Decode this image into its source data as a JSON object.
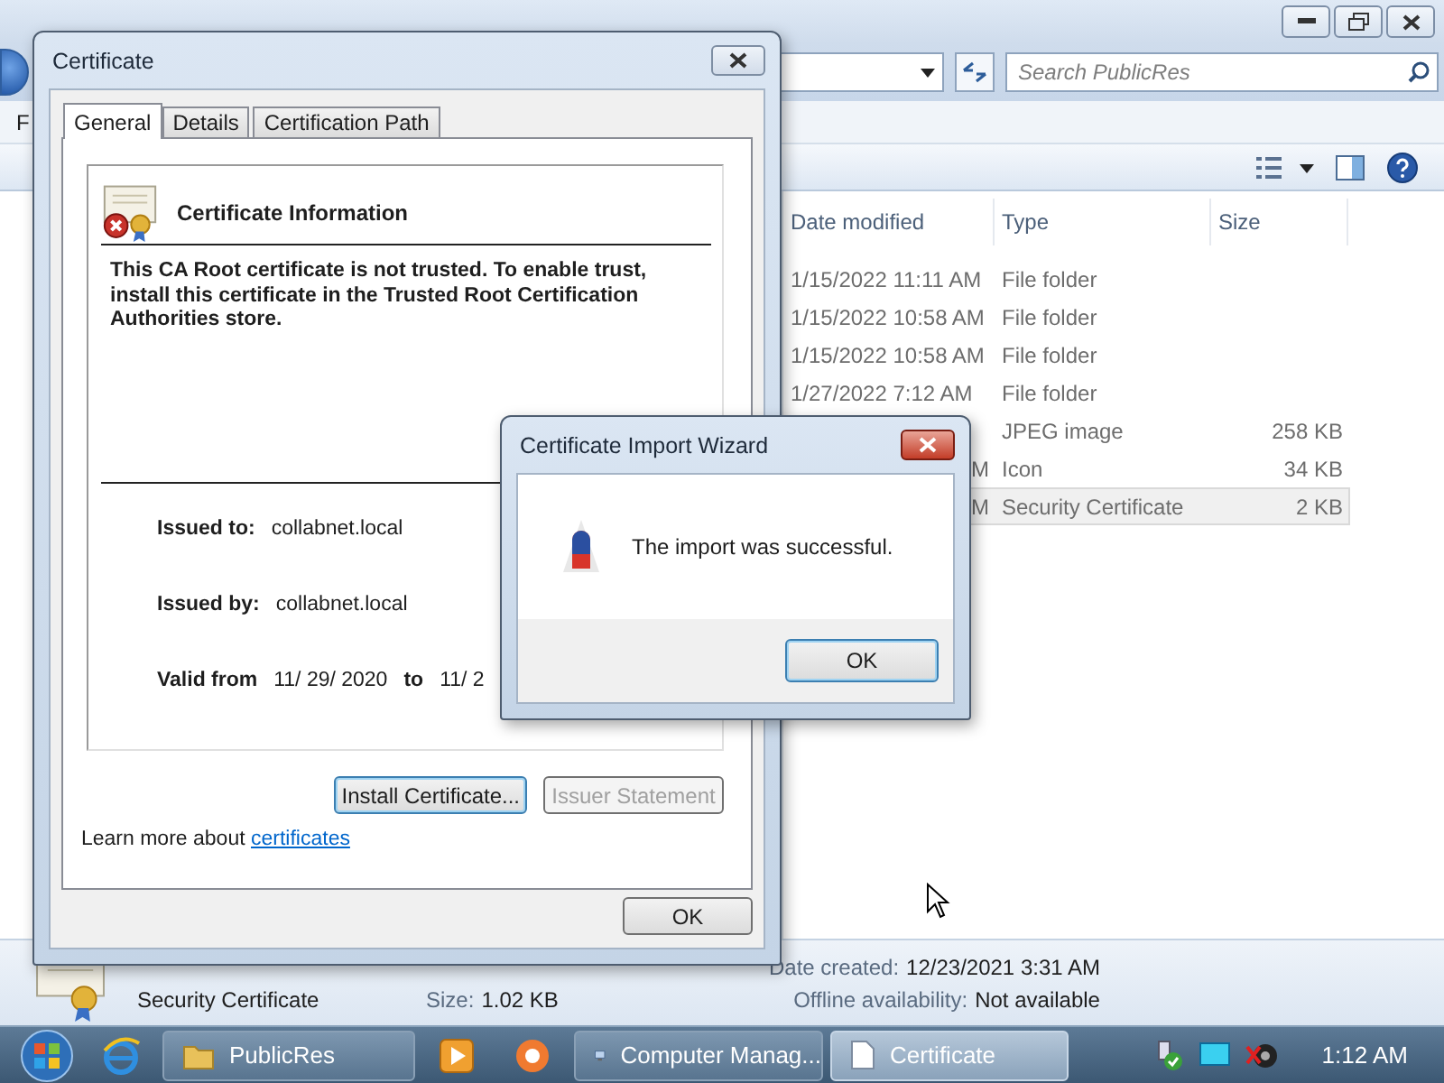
{
  "explorer": {
    "search": {
      "placeholder": "Search PublicRes"
    },
    "menu_fragment": "F",
    "columns": [
      "Date modified",
      "Type",
      "Size"
    ],
    "rows": [
      {
        "date": "1/15/2022 11:11 AM",
        "type": "File folder",
        "selected": false
      },
      {
        "date": "1/15/2022 10:58 AM",
        "type": "File folder",
        "selected": false
      },
      {
        "date": "1/15/2022 10:58 AM",
        "type": "File folder",
        "selected": false
      },
      {
        "date": "1/27/2022 7:12 AM",
        "type": "File folder",
        "selected": false
      },
      {
        "type": "JPEG image",
        "size": "258 KB",
        "selected": false
      },
      {
        "date": "M",
        "clipped": true,
        "type": "Icon",
        "size": "34 KB",
        "selected": false
      },
      {
        "date": "M",
        "clipped": true,
        "type": "Security Certificate",
        "size": "2 KB",
        "selected": true
      }
    ],
    "details": {
      "type": "Security Certificate",
      "size_label": "Size:",
      "size": "1.02 KB",
      "created_label": "Date created:",
      "created": "12/23/2021 3:31 AM",
      "offline_label": "Offline availability:",
      "offline": "Not available"
    }
  },
  "certificate": {
    "title": "Certificate",
    "tabs": [
      {
        "label": "General",
        "selected": true
      },
      {
        "label": "Details",
        "selected": false
      },
      {
        "label": "Certification Path",
        "selected": false
      }
    ],
    "heading": "Certificate Information",
    "message": "This CA Root certificate is not trusted. To enable trust, install this certificate in the Trusted Root Certification Authorities store.",
    "fields": [
      {
        "label": "Issued to:",
        "value": "collabnet.local"
      },
      {
        "label": "Issued by:",
        "value": "collabnet.local"
      }
    ],
    "valid": {
      "label": "Valid from",
      "from": "11/ 29/ 2020",
      "to_label": "to",
      "to": "11/ 2"
    },
    "buttons": [
      {
        "label": "Install Certificate...",
        "focused": true,
        "disabled": false
      },
      {
        "label": "Issuer Statement",
        "focused": false,
        "disabled": true
      }
    ],
    "learn_more": {
      "text": "Learn more about",
      "link": "certificates"
    },
    "ok": "OK"
  },
  "wizard": {
    "title": "Certificate Import Wizard",
    "message": "The import was successful.",
    "ok": "OK"
  },
  "taskbar": {
    "windows": [
      {
        "label": "PublicRes",
        "active": false
      },
      {
        "label": "Computer Manag...",
        "active": false
      },
      {
        "label": "Certificate",
        "active": true
      }
    ],
    "clock": "1:12 AM"
  }
}
